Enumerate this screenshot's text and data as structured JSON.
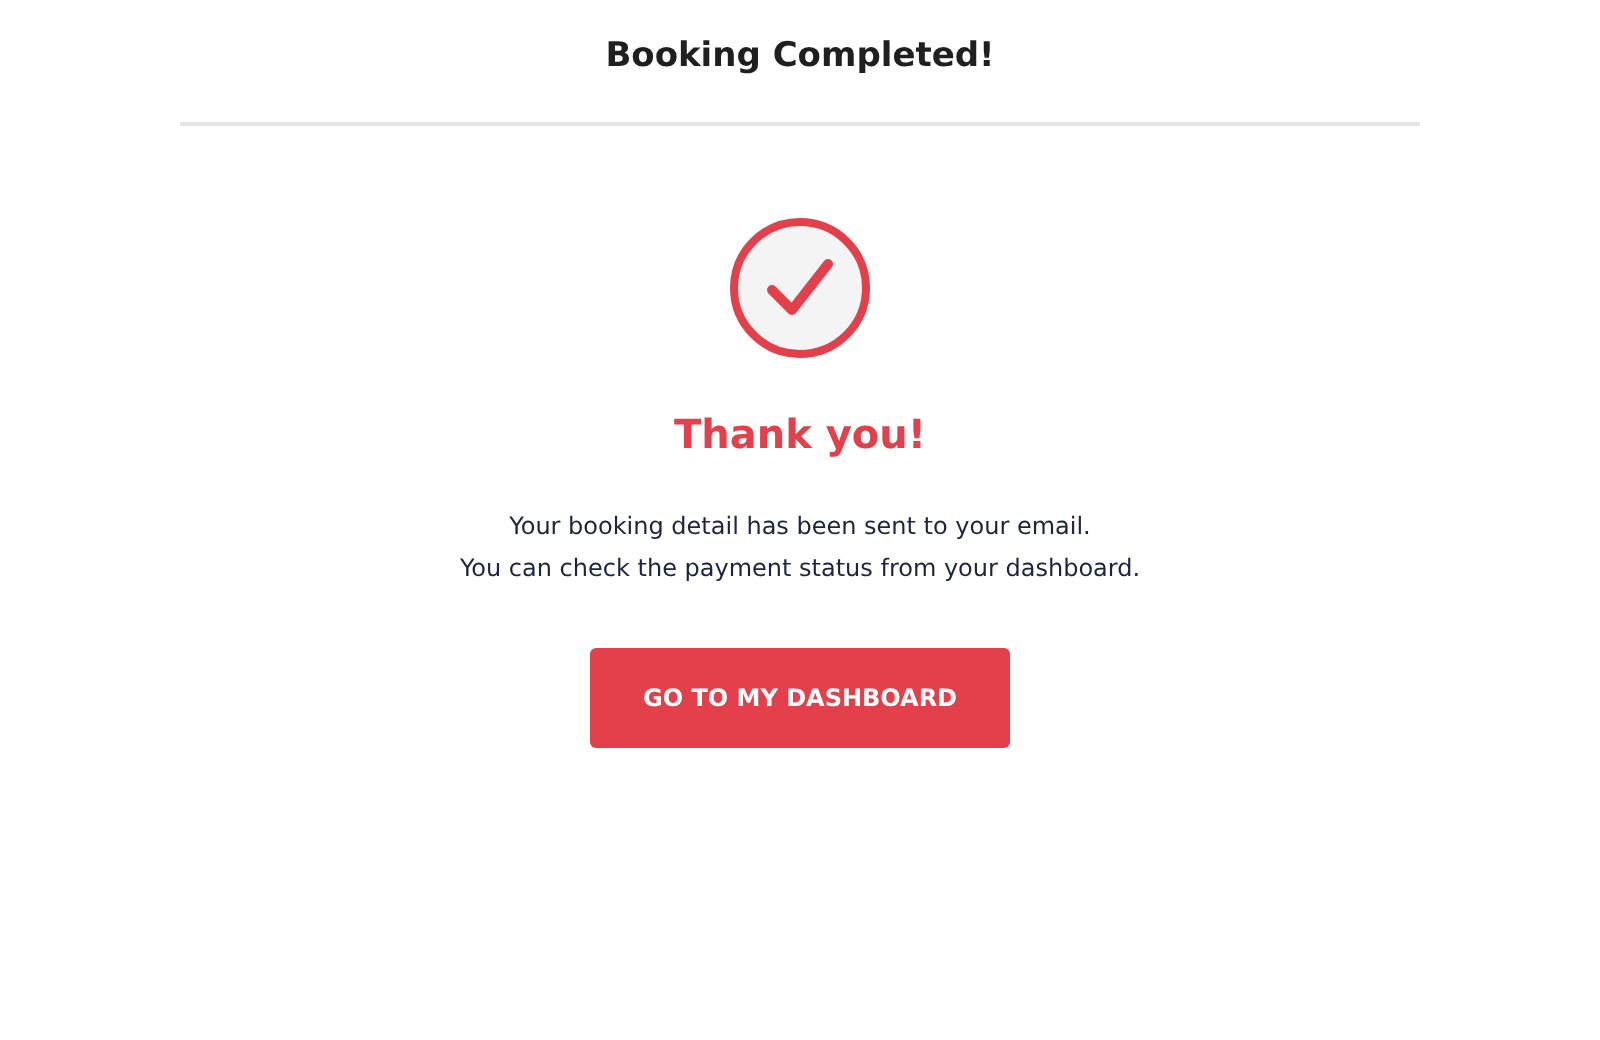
{
  "header": {
    "title": "Booking Completed!"
  },
  "confirmation": {
    "heading": "Thank you!",
    "lines": [
      "Your booking detail has been sent to your email.",
      "You can check the payment status from your dashboard."
    ]
  },
  "button": {
    "label": "GO TO MY DASHBOARD"
  }
}
